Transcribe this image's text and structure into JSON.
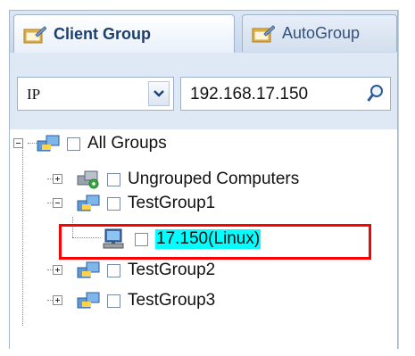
{
  "tabs": [
    {
      "label": "Client Group",
      "active": true,
      "icon": "client-group-icon"
    },
    {
      "label": "AutoGroup",
      "active": false,
      "icon": "autogroup-icon"
    }
  ],
  "filter": {
    "field_value": "IP",
    "search_value": "192.168.17.150"
  },
  "tree": {
    "root": {
      "label": "All Groups",
      "icon": "group-icon"
    },
    "ungrouped": {
      "label": "Ungrouped Computers",
      "icon": "ungrouped-computers-icon"
    },
    "testgroup1": {
      "label": "TestGroup1",
      "icon": "group-icon"
    },
    "computer": {
      "label": "17.150(Linux)",
      "icon": "linux-computer-icon"
    },
    "testgroup2": {
      "label": "TestGroup2",
      "icon": "group-icon"
    },
    "testgroup3": {
      "label": "TestGroup3",
      "icon": "group-icon"
    }
  },
  "colors": {
    "highlight": "#ff0000",
    "selected_bg": "#00ffff",
    "tab_text": "#1c3f6e"
  }
}
